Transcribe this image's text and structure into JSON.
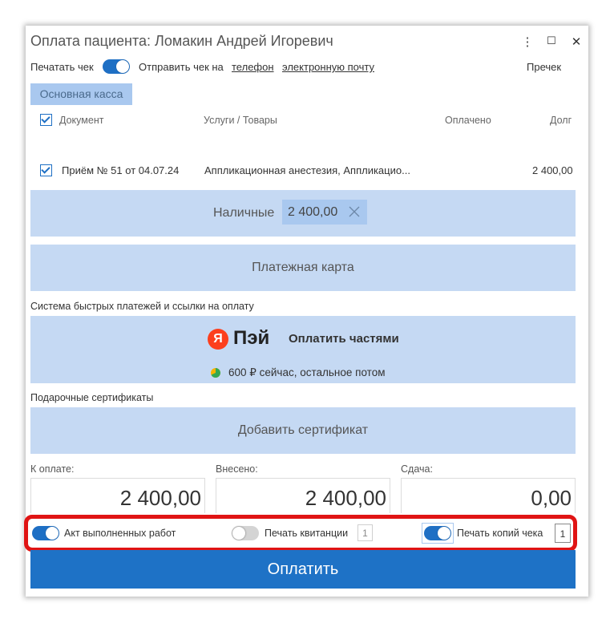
{
  "window": {
    "title": "Оплата пациента: Ломакин Андрей Игоревич",
    "menu_icon": "⋮",
    "maximize_icon": "☐",
    "close_icon": "✕"
  },
  "top_bar": {
    "print_receipt_label": "Печатать чек",
    "send_receipt_label": "Отправить чек на",
    "phone_link": "телефон",
    "email_link": "электронную почту",
    "precheck": "Пречек"
  },
  "tabs": {
    "active": "Основная касса"
  },
  "table": {
    "headers": {
      "document": "Документ",
      "services": "Услуги / Товары",
      "paid": "Оплачено",
      "debt": "Долг"
    },
    "rows": [
      {
        "document": "Приём № 51 от 04.07.24",
        "services": "Аппликационная анестезия, Аппликацио...",
        "paid": "",
        "debt": "2 400,00"
      }
    ]
  },
  "payments": {
    "cash_label": "Наличные",
    "cash_amount": "2 400,00",
    "card_label": "Платежная карта",
    "sbp_section": "Система быстрых платежей и ссылки на оплату",
    "yapay_letter": "Я",
    "yapay_brand": "Пэй",
    "yapay_split": "Оплатить частями",
    "yapay_note": "600 ₽ сейчас, остальное потом",
    "gift_section": "Подарочные сертификаты",
    "add_certificate": "Добавить сертификат"
  },
  "totals": {
    "to_pay_label": "К оплате:",
    "to_pay": "2 400,00",
    "paid_label": "Внесено:",
    "paid": "2 400,00",
    "change_label": "Сдача:",
    "change": "0,00"
  },
  "options": {
    "act_label": "Акт выполненных работ",
    "receipt_label": "Печать квитанции",
    "receipt_copies": "1",
    "check_copies_label": "Печать копий чека",
    "check_copies": "1"
  },
  "pay_button": "Оплатить",
  "colors": {
    "accent": "#1e72c6",
    "panel": "#c5d9f3",
    "highlight": "#e01414",
    "yandex": "#fc3f1d"
  }
}
